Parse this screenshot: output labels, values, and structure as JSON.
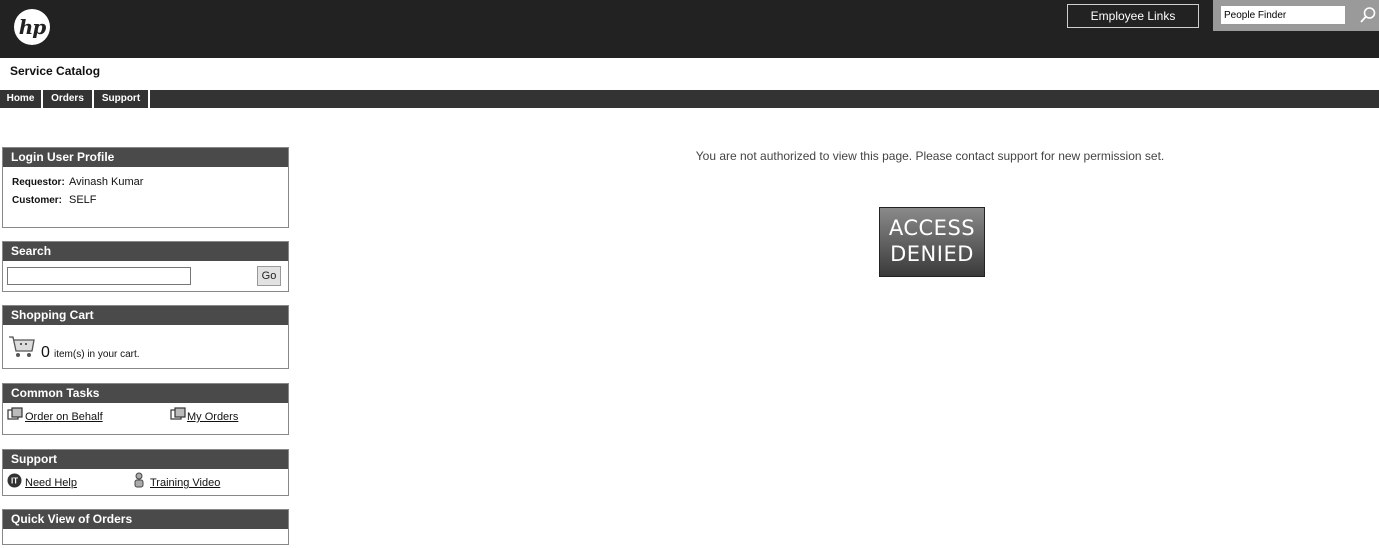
{
  "header": {
    "logo_text": "hp",
    "employee_links_label": "Employee Links",
    "people_finder_value": "People Finder"
  },
  "app": {
    "title": "Service Catalog"
  },
  "nav": {
    "items": [
      "Home",
      "Orders",
      "Support"
    ]
  },
  "sidebar": {
    "profile": {
      "title": "Login User Profile",
      "requestor_label": "Requestor:",
      "requestor_value": "Avinash Kumar",
      "customer_label": "Customer:",
      "customer_value": "SELF"
    },
    "search": {
      "title": "Search",
      "query": "",
      "go_label": "Go"
    },
    "cart": {
      "title": "Shopping Cart",
      "count": "0",
      "text": "item(s) in your cart."
    },
    "tasks": {
      "title": "Common Tasks",
      "order_on_behalf": "Order on Behalf",
      "my_orders": "My Orders"
    },
    "support": {
      "title": "Support",
      "need_help": "Need Help",
      "training_video": "Training Video"
    },
    "quick_view": {
      "title": "Quick View of Orders"
    }
  },
  "main": {
    "message": "You are not authorized to view this page. Please contact support for new permission set.",
    "denied_line1": "ACCESS",
    "denied_line2": "DENIED"
  },
  "icons": [
    "hp-logo",
    "search-icon",
    "cart-icon",
    "order-icon",
    "it-help-icon",
    "person-icon"
  ]
}
